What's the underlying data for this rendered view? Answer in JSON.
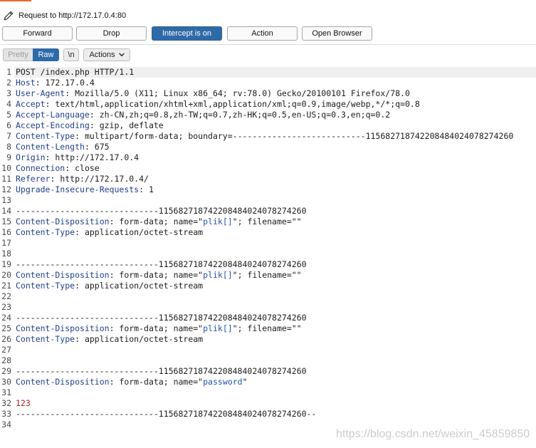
{
  "window": {
    "title": "Request to http://172.17.0.4:80"
  },
  "toolbar": {
    "forward": "Forward",
    "drop": "Drop",
    "intercept": "Intercept is on",
    "action": "Action",
    "open_browser": "Open Browser",
    "intercept_active": true
  },
  "view": {
    "pretty": "Pretty",
    "raw": "Raw",
    "newline": "\\n",
    "actions": "Actions",
    "raw_selected": true,
    "pretty_disabled": true
  },
  "icons": {
    "title": "pencil-icon",
    "actions": "chevron-down-icon"
  },
  "colors": {
    "accent": "#2f6aa8",
    "header_name": "#1f3e8c",
    "param_value": "#2553ad",
    "body_value": "#a8232b",
    "tab_indicator": "#e8692c",
    "text": "#1b1b1b",
    "line_number": "#4a4a4a",
    "current_line": "#efefef",
    "watermark": "#cccccc"
  },
  "editor": {
    "lines": [
      {
        "num": 1,
        "current": true,
        "segs": [
          {
            "t": "POST /index.php HTTP/1.1"
          }
        ]
      },
      {
        "num": 2,
        "segs": [
          {
            "h": "Host"
          },
          {
            "t": ": 172.17.0.4"
          }
        ]
      },
      {
        "num": 3,
        "segs": [
          {
            "h": "User-Agent"
          },
          {
            "t": ": Mozilla/5.0 (X11; Linux x86_64; rv:78.0) Gecko/20100101 Firefox/78.0"
          }
        ]
      },
      {
        "num": 4,
        "segs": [
          {
            "h": "Accept"
          },
          {
            "t": ": text/html,application/xhtml+xml,application/xml;q=0.9,image/webp,*/*;q=0.8"
          }
        ]
      },
      {
        "num": 5,
        "segs": [
          {
            "h": "Accept-Language"
          },
          {
            "t": ": zh-CN,zh;q=0.8,zh-TW;q=0.7,zh-HK;q=0.5,en-US;q=0.3,en;q=0.2"
          }
        ]
      },
      {
        "num": 6,
        "segs": [
          {
            "h": "Accept-Encoding"
          },
          {
            "t": ": gzip, deflate"
          }
        ]
      },
      {
        "num": 7,
        "segs": [
          {
            "h": "Content-Type"
          },
          {
            "t": ": multipart/form-data; boundary=---------------------------115682718742208484024078274260"
          }
        ]
      },
      {
        "num": 8,
        "segs": [
          {
            "h": "Content-Length"
          },
          {
            "t": ": 675"
          }
        ]
      },
      {
        "num": 9,
        "segs": [
          {
            "h": "Origin"
          },
          {
            "t": ": http://172.17.0.4"
          }
        ]
      },
      {
        "num": 10,
        "segs": [
          {
            "h": "Connection"
          },
          {
            "t": ": close"
          }
        ]
      },
      {
        "num": 11,
        "segs": [
          {
            "h": "Referer"
          },
          {
            "t": ": http://172.17.0.4/"
          }
        ]
      },
      {
        "num": 12,
        "segs": [
          {
            "h": "Upgrade-Insecure-Requests"
          },
          {
            "t": ": 1"
          }
        ]
      },
      {
        "num": 13,
        "segs": []
      },
      {
        "num": 14,
        "segs": [
          {
            "t": "-----------------------------115682718742208484024078274260"
          }
        ]
      },
      {
        "num": 15,
        "segs": [
          {
            "h": "Content-Disposition"
          },
          {
            "t": ": form-data; name=\""
          },
          {
            "p": "plik[]"
          },
          {
            "t": "\"; filename=\"\""
          }
        ]
      },
      {
        "num": 16,
        "segs": [
          {
            "h": "Content-Type"
          },
          {
            "t": ": application/octet-stream"
          }
        ]
      },
      {
        "num": 17,
        "segs": []
      },
      {
        "num": 18,
        "segs": []
      },
      {
        "num": 19,
        "segs": [
          {
            "t": "-----------------------------115682718742208484024078274260"
          }
        ]
      },
      {
        "num": 20,
        "segs": [
          {
            "h": "Content-Disposition"
          },
          {
            "t": ": form-data; name=\""
          },
          {
            "p": "plik[]"
          },
          {
            "t": "\"; filename=\"\""
          }
        ]
      },
      {
        "num": 21,
        "segs": [
          {
            "h": "Content-Type"
          },
          {
            "t": ": application/octet-stream"
          }
        ]
      },
      {
        "num": 22,
        "segs": []
      },
      {
        "num": 23,
        "segs": []
      },
      {
        "num": 24,
        "segs": [
          {
            "t": "-----------------------------115682718742208484024078274260"
          }
        ]
      },
      {
        "num": 25,
        "segs": [
          {
            "h": "Content-Disposition"
          },
          {
            "t": ": form-data; name=\""
          },
          {
            "p": "plik[]"
          },
          {
            "t": "\"; filename=\"\""
          }
        ]
      },
      {
        "num": 26,
        "segs": [
          {
            "h": "Content-Type"
          },
          {
            "t": ": application/octet-stream"
          }
        ]
      },
      {
        "num": 27,
        "segs": []
      },
      {
        "num": 28,
        "segs": []
      },
      {
        "num": 29,
        "segs": [
          {
            "t": "-----------------------------115682718742208484024078274260"
          }
        ]
      },
      {
        "num": 30,
        "segs": [
          {
            "h": "Content-Disposition"
          },
          {
            "t": ": form-data; name=\""
          },
          {
            "p": "password"
          },
          {
            "t": "\""
          }
        ]
      },
      {
        "num": 31,
        "segs": []
      },
      {
        "num": 32,
        "segs": [
          {
            "v": "123"
          }
        ]
      },
      {
        "num": 33,
        "segs": [
          {
            "t": "-----------------------------115682718742208484024078274260--"
          }
        ]
      },
      {
        "num": 34,
        "segs": []
      }
    ]
  },
  "watermark": {
    "text": "https://blog.csdn.net/weixin_45859850"
  }
}
